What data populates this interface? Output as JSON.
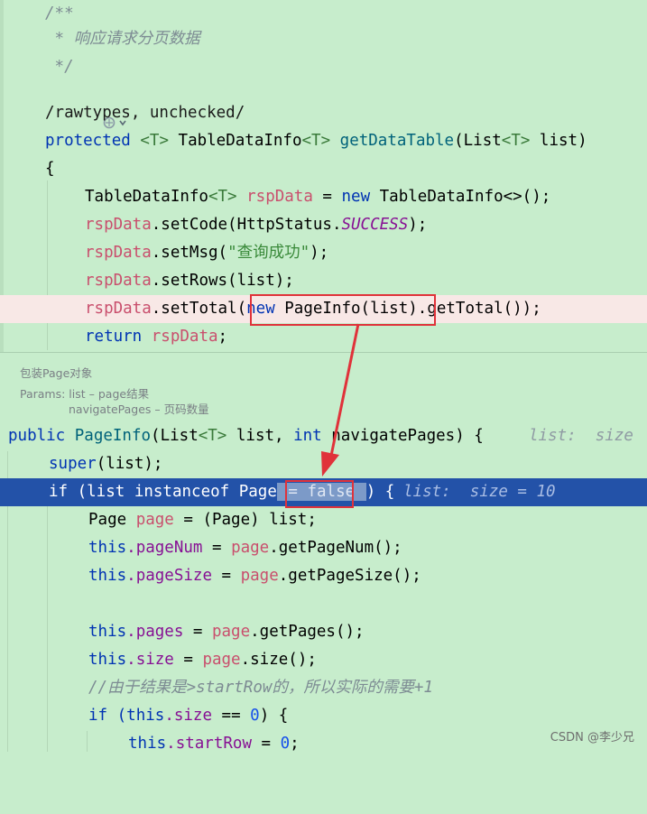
{
  "top": {
    "l1": "/**",
    "l2": " * 响应请求分页数据",
    "l3": " */",
    "annotation": "/rawtypes, unchecked/",
    "sig_protected": "protected",
    "sig_T": "<T>",
    "sig_cls": "TableDataInfo",
    "sig_T2": "<T>",
    "sig_fn": "getDataTable",
    "sig_paren": "(List",
    "sig_T3": "<T>",
    "sig_param": " list)",
    "brace": "{",
    "r1_type": "TableDataInfo",
    "r1_T": "<T>",
    "r1_var": "rspData",
    "r1_eq": " = ",
    "r1_new": "new",
    "r1_rest": " TableDataInfo<>();",
    "r2_var": "rspData",
    "r2_call": ".setCode(HttpStatus.",
    "r2_const": "SUCCESS",
    "r2_end": ");",
    "r3_var": "rspData",
    "r3_call": ".setMsg(",
    "r3_str": "\"查询成功\"",
    "r3_end": ");",
    "r4_var": "rspData",
    "r4_call": ".setRows(list);",
    "r5_var": "rspData",
    "r5_call": ".setTotal(",
    "r5_new": "new",
    "r5_mid": " PageInfo(list)",
    "r5_end": ".getTotal());",
    "r6_ret": "return",
    "r6_var": "rspData",
    "r6_end": ";"
  },
  "doc": {
    "title": "包装Page对象",
    "params": "Params: list – page结果",
    "params2": "navigatePages – 页码数量"
  },
  "bottom": {
    "b1_kw": "public",
    "b1_fn": " PageInfo",
    "b1_a": "(List",
    "b1_T": "<T>",
    "b1_b": " list, ",
    "b1_int": "int",
    "b1_c": " navigatePages) {",
    "b1_hint": "list:  size",
    "b2_super": "super",
    "b2_rest": "(list);",
    "b3_if": "if (list instanceof Page",
    "b3_chip": " = false ",
    "b3_end": ") {",
    "b3_hint": "list:  size = 10",
    "b4_a": "Page ",
    "b4_var": "page",
    "b4_b": " = (Page) list;",
    "b5_this": "this",
    "b5_fld": ".pageNum",
    "b5_eq": " = ",
    "b5_var": "page",
    "b5_end": ".getPageNum();",
    "b6_this": "this",
    "b6_fld": ".pageSize",
    "b6_eq": " = ",
    "b6_var": "page",
    "b6_end": ".getPageSize();",
    "b7_this": "this",
    "b7_fld": ".pages",
    "b7_eq": " = ",
    "b7_var": "page",
    "b7_end": ".getPages();",
    "b8_this": "this",
    "b8_fld": ".size",
    "b8_eq": " = ",
    "b8_var": "page",
    "b8_end": ".size();",
    "b9_cmt": "//由于结果是>startRow的，所以实际的需要+1",
    "b10_if": "if (",
    "b10_this": "this",
    "b10_fld": ".size",
    "b10_eq": " == ",
    "b10_num": "0",
    "b10_end": ") {",
    "b11_this": "this",
    "b11_fld": ".startRow",
    "b11_eq": " = ",
    "b11_num": "0",
    "b11_end": ";"
  },
  "watermark": "CSDN @李少兄"
}
